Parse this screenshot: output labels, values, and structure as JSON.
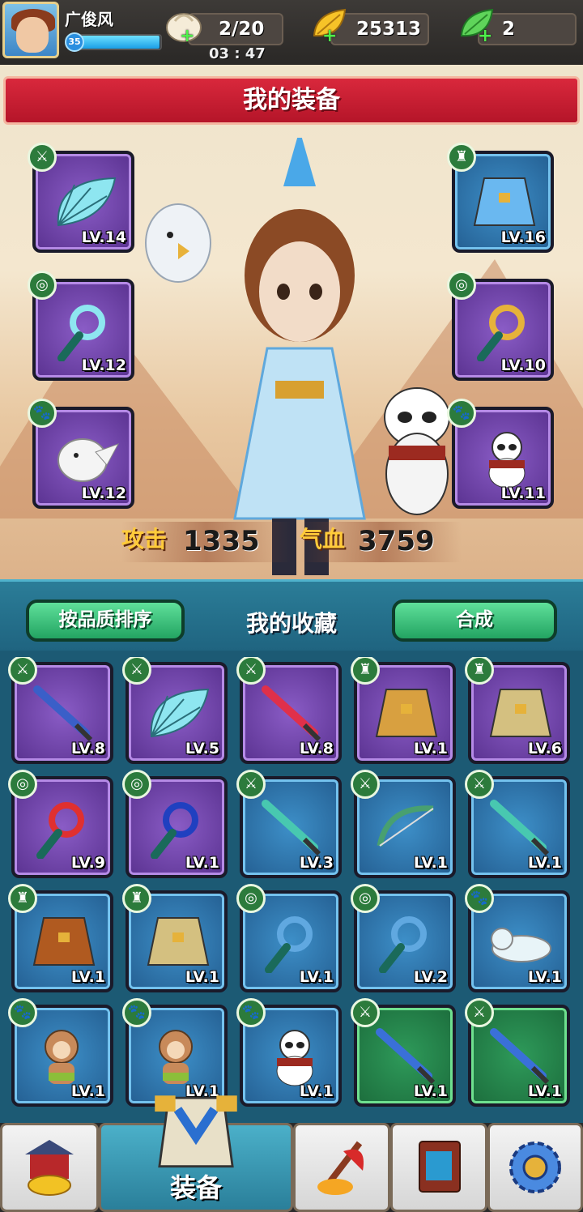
{
  "player": {
    "name": "广俊风",
    "level": "35",
    "xp_fraction": 0.99
  },
  "resources": {
    "stamina": {
      "value": "2/20",
      "icon": "bun-icon"
    },
    "gold": {
      "value": "25313",
      "icon": "gold-leaf-icon"
    },
    "jade": {
      "value": "2",
      "icon": "jade-leaf-icon"
    }
  },
  "timer": "03 : 47",
  "equipment": {
    "title": "我的装备",
    "slots": [
      {
        "side": "left",
        "kind": "fan",
        "badge": "weapon",
        "level": "LV.14",
        "quality": "purple"
      },
      {
        "side": "left",
        "kind": "pendant",
        "badge": "accessory",
        "level": "LV.12",
        "quality": "purple"
      },
      {
        "side": "left",
        "kind": "owl",
        "badge": "pet",
        "level": "LV.12",
        "quality": "purple"
      },
      {
        "side": "right",
        "kind": "coat",
        "badge": "armor",
        "level": "LV.16",
        "quality": "blue"
      },
      {
        "side": "right",
        "kind": "pendant-gold",
        "badge": "accessory",
        "level": "LV.10",
        "quality": "purple"
      },
      {
        "side": "right",
        "kind": "panda",
        "badge": "pet",
        "level": "LV.11",
        "quality": "purple"
      }
    ],
    "attack_label": "攻击",
    "attack_value": "1335",
    "hp_label": "气血",
    "hp_value": "3759"
  },
  "collection": {
    "title": "我的收藏",
    "sort_button": "按品质排序",
    "compose_button": "合成",
    "items": [
      {
        "kind": "sword",
        "badge": "weapon",
        "level": "LV.8",
        "quality": "purple",
        "color": "#3a5fc8"
      },
      {
        "kind": "fan",
        "badge": "weapon",
        "level": "LV.5",
        "quality": "purple",
        "color": "#8ee6f0"
      },
      {
        "kind": "sword",
        "badge": "weapon",
        "level": "LV.8",
        "quality": "purple",
        "color": "#e0304a"
      },
      {
        "kind": "armor",
        "badge": "armor",
        "level": "LV.1",
        "quality": "purple",
        "color": "#d8a040"
      },
      {
        "kind": "armor",
        "badge": "armor",
        "level": "LV.6",
        "quality": "purple",
        "color": "#d4c080"
      },
      {
        "kind": "pendant",
        "badge": "accessory",
        "level": "LV.9",
        "quality": "purple",
        "color": "#e03030"
      },
      {
        "kind": "pendant",
        "badge": "accessory",
        "level": "LV.1",
        "quality": "purple",
        "color": "#2040c0"
      },
      {
        "kind": "sword",
        "badge": "weapon",
        "level": "LV.3",
        "quality": "blue",
        "color": "#48c8b0"
      },
      {
        "kind": "bow",
        "badge": "weapon",
        "level": "LV.1",
        "quality": "blue",
        "color": "#48a070"
      },
      {
        "kind": "sword",
        "badge": "weapon",
        "level": "LV.1",
        "quality": "blue",
        "color": "#48c8b0"
      },
      {
        "kind": "armor",
        "badge": "armor",
        "level": "LV.1",
        "quality": "blue",
        "color": "#b05a20"
      },
      {
        "kind": "armor",
        "badge": "armor",
        "level": "LV.1",
        "quality": "blue",
        "color": "#d4c080"
      },
      {
        "kind": "pendant",
        "badge": "accessory",
        "level": "LV.1",
        "quality": "blue",
        "color": "#60a8e0"
      },
      {
        "kind": "pendant",
        "badge": "accessory",
        "level": "LV.2",
        "quality": "blue",
        "color": "#60a8e0"
      },
      {
        "kind": "ferret",
        "badge": "pet",
        "level": "LV.1",
        "quality": "blue",
        "color": "#e8f4f8"
      },
      {
        "kind": "monkey",
        "badge": "pet",
        "level": "LV.1",
        "quality": "blue",
        "color": "#c88a5a"
      },
      {
        "kind": "monkey",
        "badge": "pet",
        "level": "LV.1",
        "quality": "blue",
        "color": "#c88a5a"
      },
      {
        "kind": "panda",
        "badge": "pet",
        "level": "LV.1",
        "quality": "blue",
        "color": "#ffffff"
      },
      {
        "kind": "sword",
        "badge": "weapon",
        "level": "LV.1",
        "quality": "green",
        "color": "#3a70d8"
      },
      {
        "kind": "sword",
        "badge": "weapon",
        "level": "LV.1",
        "quality": "green",
        "color": "#3a70d8"
      }
    ]
  },
  "tabs": [
    {
      "name": "shop",
      "label": "",
      "icon": "treasure-house-icon"
    },
    {
      "name": "equipment",
      "label": "装备",
      "icon": "armor-icon",
      "active": true
    },
    {
      "name": "battle",
      "label": "",
      "icon": "battle-axe-icon"
    },
    {
      "name": "book",
      "label": "",
      "icon": "book-icon"
    },
    {
      "name": "settings",
      "label": "",
      "icon": "gear-icon"
    }
  ],
  "colors": {
    "accent_green": "#23a462",
    "banner_red": "#c91e33",
    "panel_teal": "#1c5a74"
  }
}
